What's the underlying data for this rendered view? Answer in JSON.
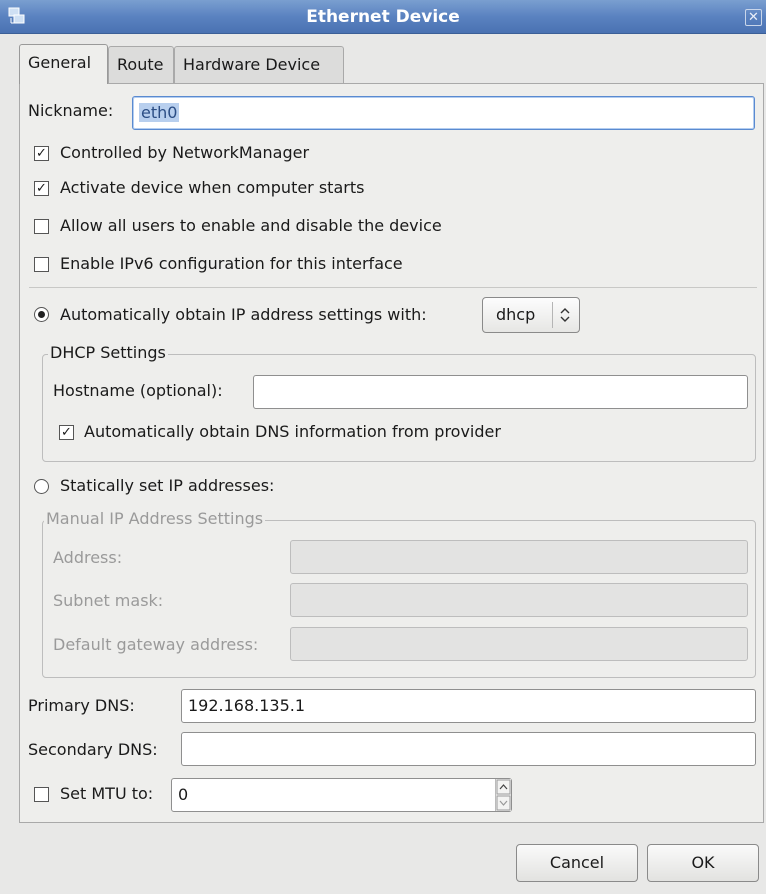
{
  "window": {
    "title": "Ethernet Device",
    "close_glyph": "✕"
  },
  "tabs": [
    {
      "label": "General"
    },
    {
      "label": "Route"
    },
    {
      "label": "Hardware Device"
    }
  ],
  "general": {
    "nickname_label": "Nickname:",
    "nickname_value": "eth0",
    "controlled_nm": {
      "label": "Controlled by NetworkManager",
      "checked": true
    },
    "activate_on_boot": {
      "label": "Activate device when computer starts",
      "checked": true
    },
    "allow_users": {
      "label": "Allow all users to enable and disable the device",
      "checked": false
    },
    "enable_ipv6": {
      "label": "Enable IPv6 configuration for this interface",
      "checked": false
    },
    "auto_ip": {
      "label": "Automatically obtain IP address settings with:",
      "selected": true,
      "method": "dhcp"
    },
    "dhcp": {
      "frame_label": "DHCP Settings",
      "hostname_label": "Hostname (optional):",
      "hostname_value": "",
      "auto_dns": {
        "label": "Automatically obtain DNS information from provider",
        "checked": true
      }
    },
    "static_ip": {
      "label": "Statically set IP addresses:",
      "selected": false
    },
    "manual": {
      "frame_label": "Manual IP Address Settings",
      "address_label": "Address:",
      "subnet_label": "Subnet mask:",
      "gateway_label": "Default gateway address:"
    },
    "primary_dns_label": "Primary DNS:",
    "primary_dns_value": "192.168.135.1",
    "secondary_dns_label": "Secondary DNS:",
    "secondary_dns_value": "",
    "mtu": {
      "label": "Set MTU to:",
      "checked": false,
      "value": "0"
    }
  },
  "buttons": {
    "cancel": "Cancel",
    "ok": "OK"
  }
}
